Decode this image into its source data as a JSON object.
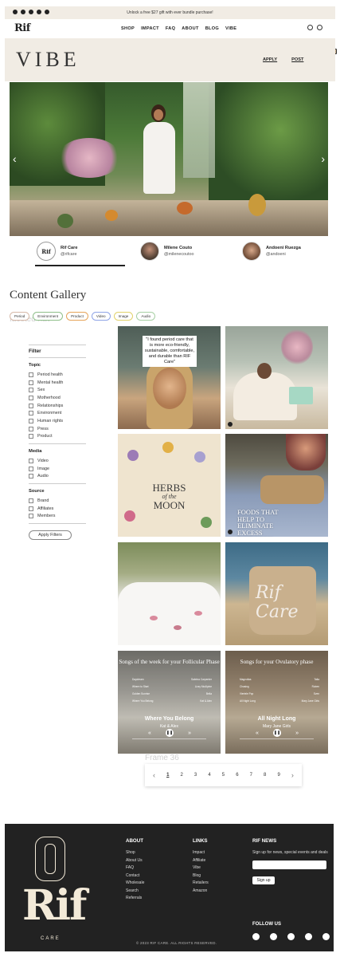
{
  "announcement": {
    "message": "Unlock a free $27 gift with ever bundle purchase!",
    "socials": [
      "facebook-icon",
      "instagram-icon",
      "tiktok-icon",
      "youtube-icon",
      "pinterest-icon"
    ]
  },
  "nav": {
    "logo": "Rif",
    "menu": [
      "SHOP",
      "IMPACT",
      "FAQ",
      "ABOUT",
      "BLOG",
      "VIBE"
    ],
    "icons": [
      "account-icon",
      "search-icon",
      "bag-icon"
    ]
  },
  "vibe": {
    "title": "VIBE",
    "links": [
      "APPLY",
      "POST"
    ]
  },
  "creators": [
    {
      "name": "Rif Care",
      "handle": "@rifcare",
      "avatar_text": "Rif"
    },
    {
      "name": "Milene Couto",
      "handle": "@milenecoutoo"
    },
    {
      "name": "Andoeni Ruezga",
      "handle": "@andoeni"
    }
  ],
  "gallery": {
    "title": "Content Gallery",
    "chips": [
      "Period",
      "Environment",
      "Product",
      "Video",
      "Image",
      "Audio"
    ],
    "faceted_label": "faceted nav",
    "frame_label": "Frame 36"
  },
  "filter": {
    "title": "Filter",
    "sections": [
      {
        "name": "Topic",
        "items": [
          "Period health",
          "Mental health",
          "Sex",
          "Motherhood",
          "Relationships",
          "Environment",
          "Human rights",
          "Press",
          "Product"
        ]
      },
      {
        "name": "Media",
        "items": [
          "Video",
          "Image",
          "Audio"
        ]
      },
      {
        "name": "Source",
        "items": [
          "Brand",
          "Affiliates",
          "Members"
        ]
      }
    ],
    "apply_label": "Apply Filters"
  },
  "tiles": {
    "quote": "\"I found period care that is more eco-friendly, sustainable, comfortable, and durable than RIF Care\"",
    "herbs_line1": "HERBS",
    "herbs_line2": "of the",
    "herbs_line3": "MOON",
    "estrogen": "FOODS THAT HELP TO ELIMINATE EXCESS ESTROGEN",
    "bag_script": "Rif Care",
    "songs_follicular": {
      "title": "Songs of the week for your Follicular Phase",
      "rows": [
        [
          "Daydream",
          "Sabrina Carpenter"
        ],
        [
          "Where to Start",
          "Lizzy McAlpine"
        ],
        [
          "Golden Sunrise",
          "Bella"
        ],
        [
          "Where You Belong",
          "Kat & Alex"
        ]
      ],
      "now_playing": "Where You Belong",
      "artist": "Kat & Alex"
    },
    "songs_ovulatory": {
      "title": "Songs for your Ovulatory phase",
      "rows": [
        [
          "Magnolias",
          "Talia"
        ],
        [
          "Chasing",
          "Ruben"
        ],
        [
          "Viertele Pop",
          "Sven"
        ],
        [
          "All Night Long",
          "Mary Jane Girls"
        ]
      ],
      "now_playing": "All Night Long",
      "artist": "Mary Jane Girls"
    }
  },
  "pagination": {
    "prev": "‹",
    "pages": [
      "1",
      "2",
      "3",
      "4",
      "5",
      "6",
      "7",
      "8",
      "9"
    ],
    "current": "1",
    "next": "›"
  },
  "footer": {
    "logo": "Rif",
    "logo_sub": "CARE",
    "about_head": "ABOUT",
    "about_links": [
      "Shop",
      "About Us",
      "FAQ",
      "Contact",
      "Wholesale",
      "Search",
      "Referrals"
    ],
    "links_head": "LINKS",
    "links_links": [
      "Impact",
      "Affiliate",
      "Vibe",
      "Blog",
      "Retailers",
      "Amazon"
    ],
    "news_head": "RIF NEWS",
    "news_text": "Sign up for news, special events and deals",
    "signup_label": "Sign up",
    "follow_label": "FOLLOW US",
    "follow_icons": [
      "facebook-icon",
      "instagram-icon",
      "tiktok-icon",
      "youtube-icon",
      "pinterest-icon"
    ],
    "copyright": "© 2023 RIF CARE. ALL RIGHTS RESERVED."
  }
}
